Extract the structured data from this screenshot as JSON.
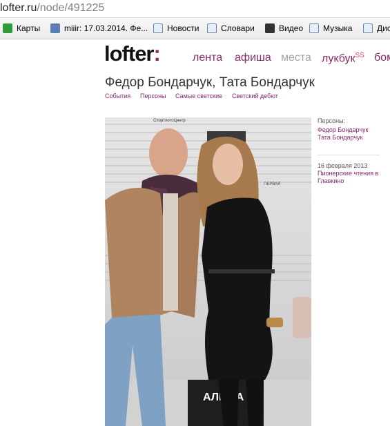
{
  "browser": {
    "url_host": "lofter.ru",
    "url_path": "/node/491225",
    "bookmarks": [
      {
        "label": "Карты",
        "icon": "maps-icon"
      },
      {
        "label": "miiir: 17.03.2014. Фе...",
        "icon": "user-icon"
      },
      {
        "label": "Новости",
        "icon": "page-icon"
      },
      {
        "label": "Словари",
        "icon": "dictionary-icon"
      },
      {
        "label": "Видео",
        "icon": "video-icon"
      },
      {
        "label": "Музыка",
        "icon": "music-icon"
      },
      {
        "label": "Дис",
        "icon": "mail-icon"
      }
    ]
  },
  "site": {
    "logo": "lofter",
    "logo_mark": ":",
    "nav": [
      {
        "label": "лента"
      },
      {
        "label": "афиша"
      },
      {
        "label": "места"
      },
      {
        "label": "лукбук",
        "sup": "SS"
      },
      {
        "label": "бом"
      }
    ],
    "accent": "#8a2a6a"
  },
  "article": {
    "title": "Федор Бондарчук, Тата Бондарчук",
    "tags": [
      "События",
      "Персоны",
      "Самые светские",
      "Светский дебют"
    ],
    "photo_caption_alt": "Федор Бондарчук, Тата Бондарчук"
  },
  "sidebar": {
    "persons_label": "Персоны:",
    "persons": [
      "Федор Бондарчук",
      "Тата Бондарчук"
    ],
    "date": "16 февраля 2013",
    "event": "Пионерские чтения в Главкино"
  },
  "photo_text": {
    "sign_top": "СпортлотоЦентр",
    "sign_side": "ПЕРВАЯ",
    "brand": "АЛЬФА"
  }
}
